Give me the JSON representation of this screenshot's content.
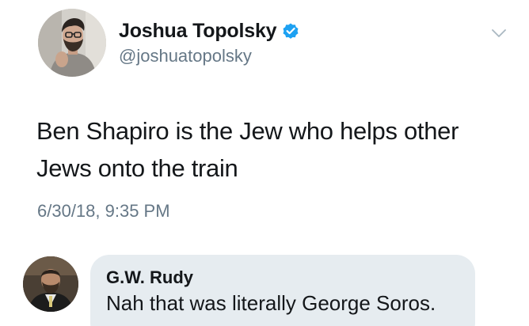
{
  "author": {
    "display_name": "Joshua Topolsky",
    "handle": "@joshuatopolsky",
    "verified": true,
    "avatar_icon": "profile-photo"
  },
  "tweet": {
    "text": "Ben Shapiro is the Jew who helps other\nJews onto the train",
    "timestamp": "6/30/18, 9:35 PM"
  },
  "reply": {
    "author_name": "G.W. Rudy",
    "text": "Nah that was literally George Soros.",
    "avatar_icon": "profile-photo"
  },
  "colors": {
    "verified_blue": "#1da1f2",
    "secondary_text": "#657786",
    "reply_bubble": "#e6ecf0"
  }
}
